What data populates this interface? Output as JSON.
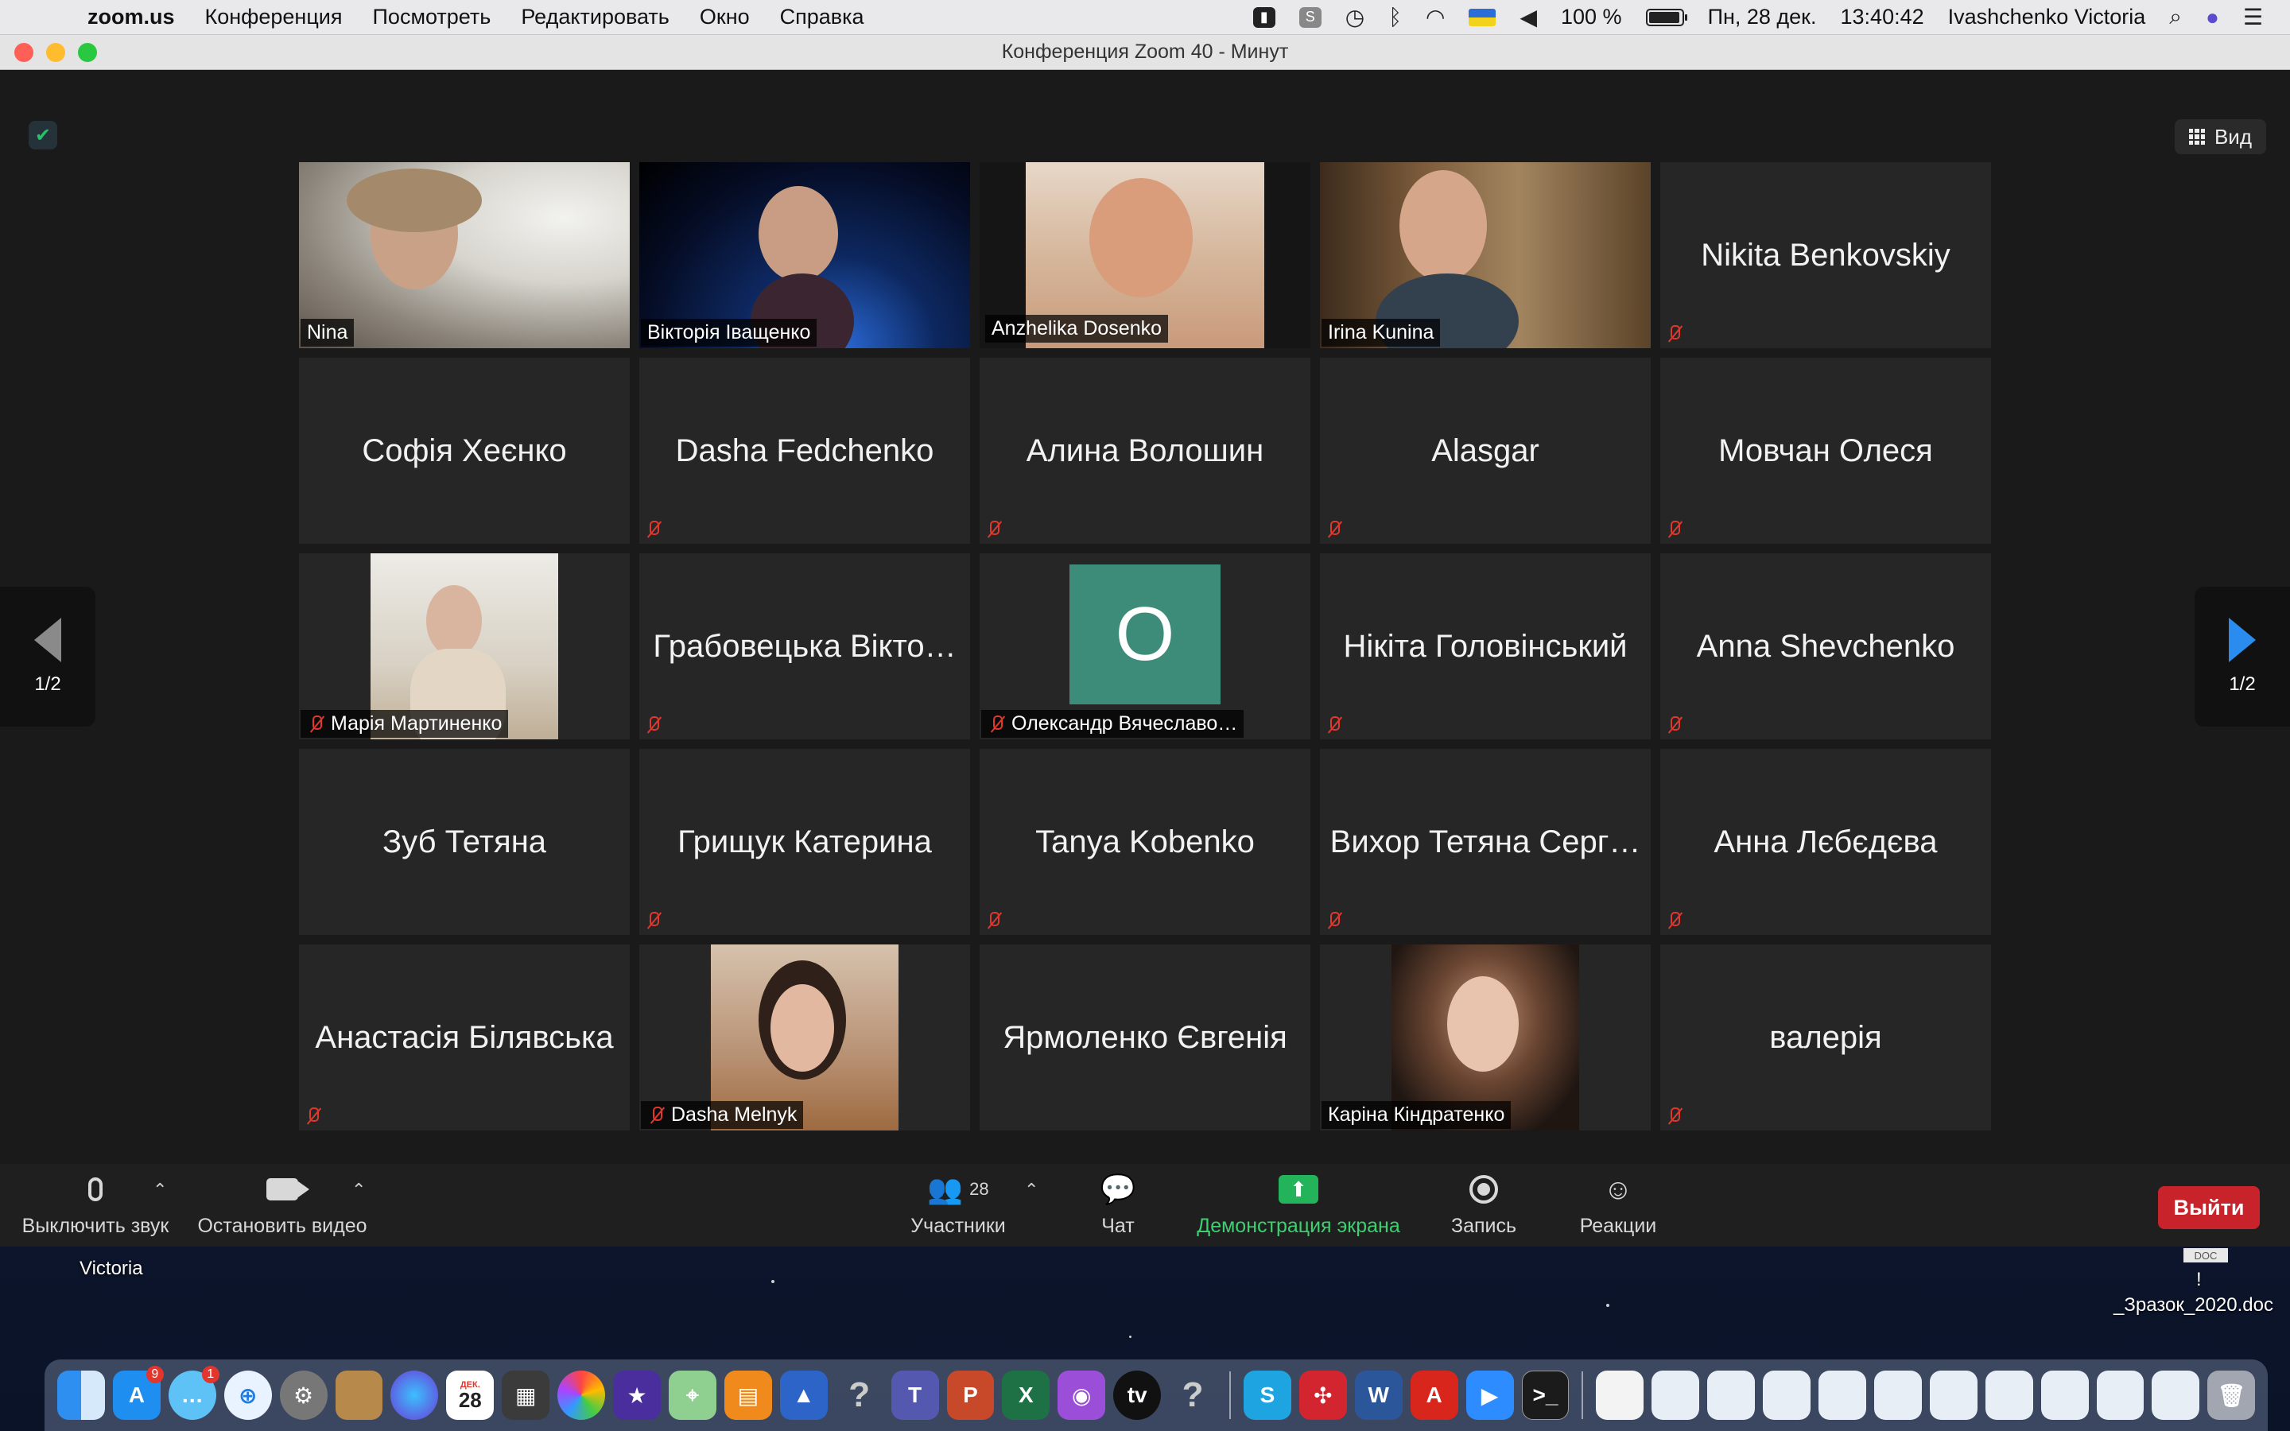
{
  "menubar": {
    "app_name": "zoom.us",
    "menus": [
      "Конференция",
      "Посмотреть",
      "Редактировать",
      "Окно",
      "Справка"
    ],
    "battery": "100 %",
    "date": "Пн, 28 дек.",
    "time": "13:40:42",
    "user": "Ivashchenko Victoria"
  },
  "window": {
    "title": "Конференция Zoom   40 - Минут",
    "view_label": "Вид"
  },
  "pager": {
    "left": "1/2",
    "right": "1/2"
  },
  "tiles": [
    {
      "name": "Nina"
    },
    {
      "name": "Вікторія Іващенко"
    },
    {
      "name": "Anzhelika Dosenko"
    },
    {
      "name": "Irina Kunina"
    },
    {
      "name": "Nikita Benkovskiy"
    },
    {
      "name": "Софія Хеєнко"
    },
    {
      "name": "Dasha Fedchenko"
    },
    {
      "name": "Алина Волошин"
    },
    {
      "name": "Alasgar"
    },
    {
      "name": "Мовчан Олеся"
    },
    {
      "name": "Марія Мартиненко"
    },
    {
      "name": "Грабовецька Вікто…"
    },
    {
      "name": "Олександр Вячеславо…",
      "initial": "O"
    },
    {
      "name": "Нікіта Головінський"
    },
    {
      "name": "Anna Shevchenko"
    },
    {
      "name": "Зуб Тетяна"
    },
    {
      "name": "Грищук Катерина"
    },
    {
      "name": "Tanya Kobenko"
    },
    {
      "name": "Вихор Тетяна Серг…"
    },
    {
      "name": "Анна Лєбєдєва"
    },
    {
      "name": "Анастасія Білявська"
    },
    {
      "name": "Dasha Melnyk"
    },
    {
      "name": "Ярмоленко Євгенія"
    },
    {
      "name": "Каріна Кіндратенко"
    },
    {
      "name": "валерія"
    }
  ],
  "toolbar": {
    "mute": "Выключить звук",
    "video": "Остановить видео",
    "participants": "Участники",
    "participants_count": "28",
    "chat": "Чат",
    "share": "Демонстрация экрана",
    "record": "Запись",
    "reactions": "Реакции",
    "exit": "Выйти"
  },
  "desktop": {
    "user_label": "Victoria",
    "file_label": "_Зразок_2020.doc",
    "file_type": "DOC",
    "file_mark": "!"
  },
  "dock": {
    "appstore_badge": "9",
    "messages_badge": "1",
    "calendar_month": "ДЕК.",
    "calendar_day": "28"
  },
  "colors": {
    "active_speaker": "#dfe78b",
    "share_green": "#23b35b",
    "exit_red": "#c8232b",
    "avatar_teal": "#3d8c7a"
  }
}
